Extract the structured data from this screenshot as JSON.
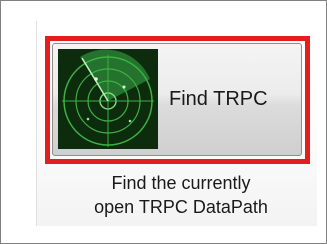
{
  "button": {
    "label": "Find TRPC",
    "icon": "radar-icon"
  },
  "description": {
    "line1": "Find the currently",
    "line2": "open TRPC DataPath"
  },
  "colors": {
    "highlight": "#e41e1e",
    "radar_background": "#0d2b0d",
    "radar_line": "#3cb043"
  }
}
